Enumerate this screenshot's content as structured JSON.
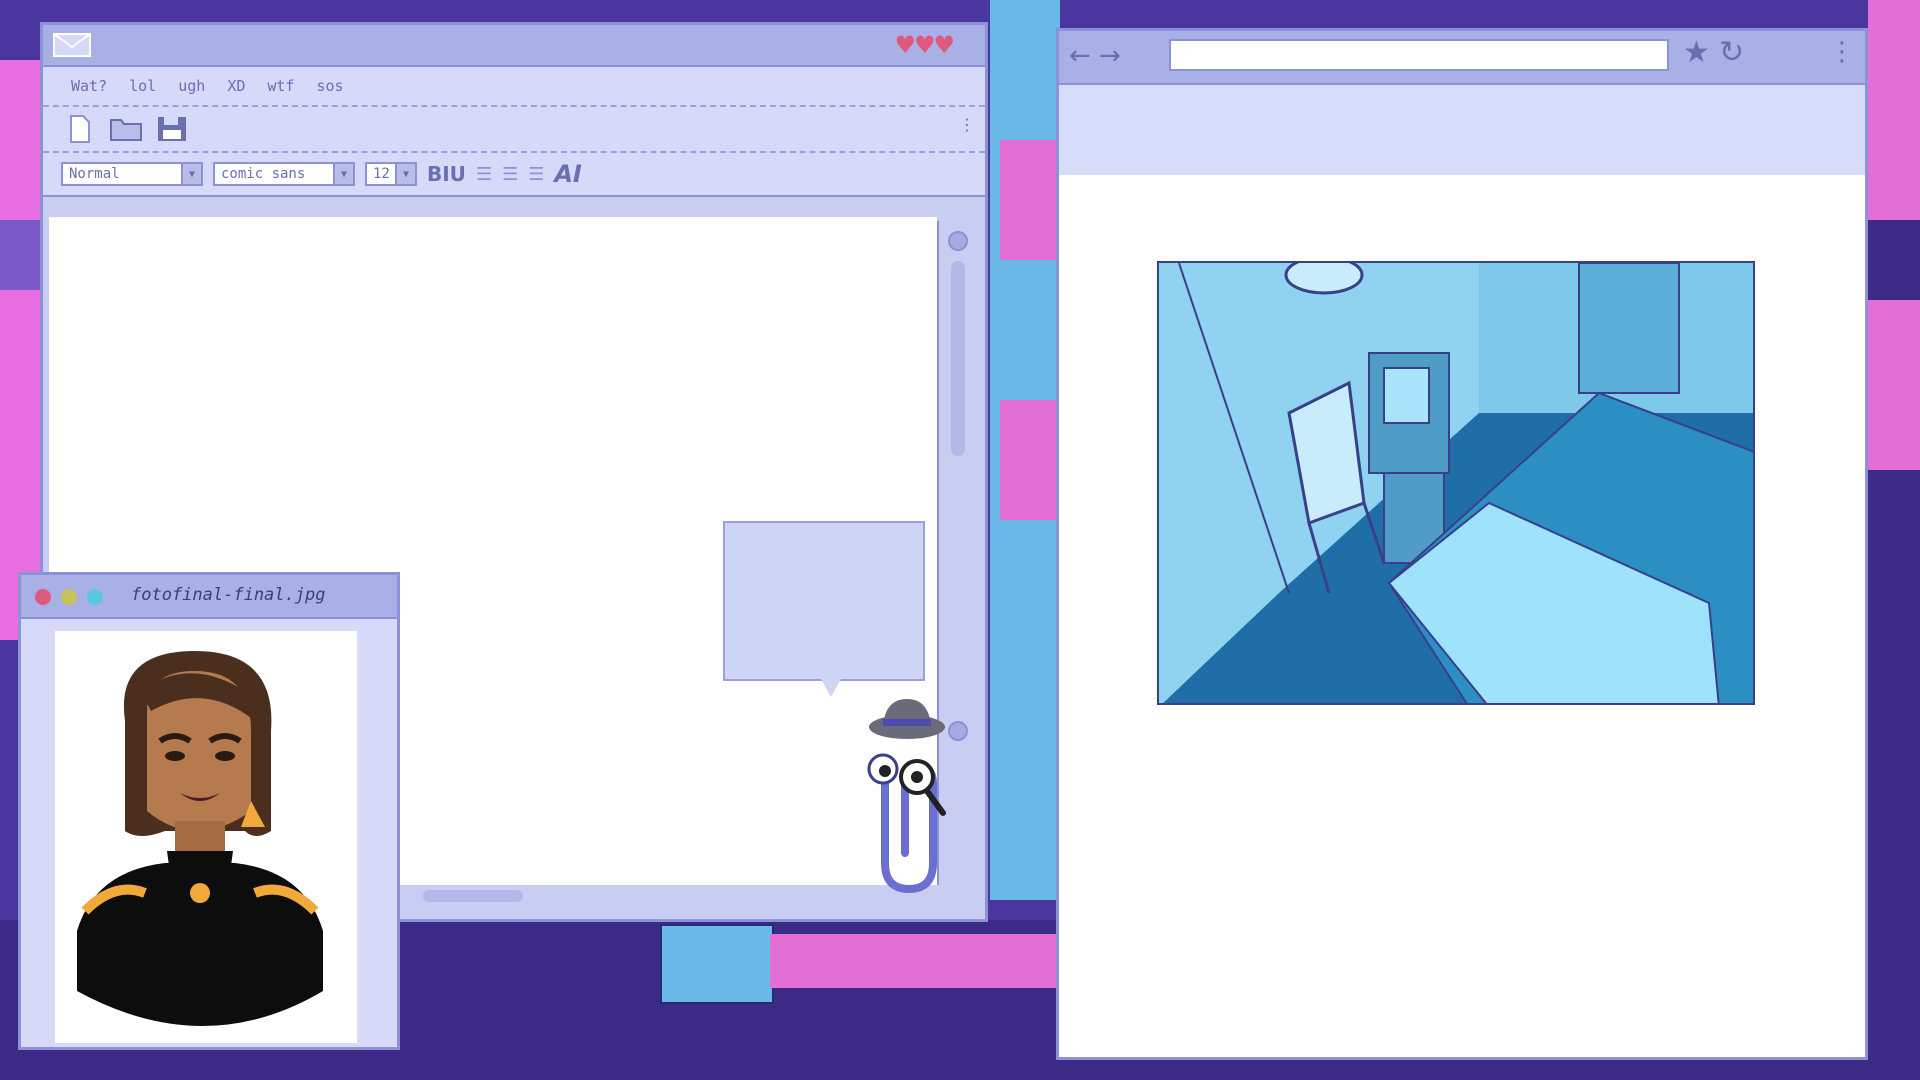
{
  "editor": {
    "menu": [
      "Wat?",
      "lol",
      "ugh",
      "XD",
      "wtf",
      "sos"
    ],
    "style_value": "Normal",
    "font_value": "comic sans",
    "size_value": "12",
    "format_label": "BIU",
    "ai_label": "AI",
    "hearts": "♥♥♥",
    "colors": {
      "window": "#c9cdf2",
      "titlebar": "#a9b0e6",
      "border": "#8d92d6",
      "accent": "#e0587d"
    }
  },
  "viewer": {
    "filename": "fotofinal-final.jpg",
    "traffic_colors": [
      "#e0587d",
      "#c7c25a",
      "#5ac7e0"
    ]
  },
  "browser": {
    "url": "",
    "back_icon": "←",
    "forward_icon": "→",
    "star_icon": "★",
    "reload_icon": "↻",
    "menu_icon": "⋮"
  }
}
